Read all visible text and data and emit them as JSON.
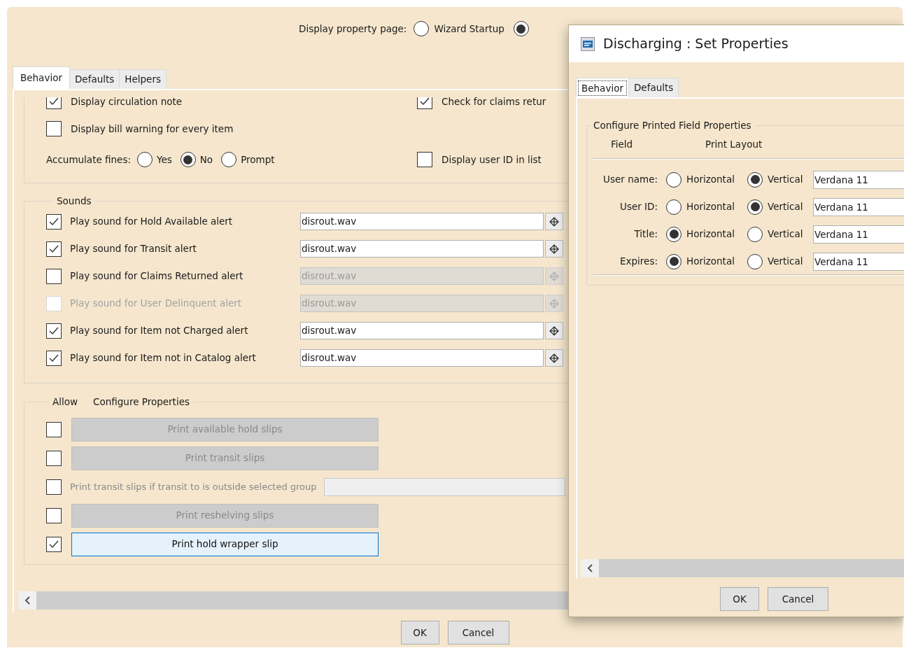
{
  "main_window": {
    "display_property_page": {
      "label": "Display property page:",
      "options": [
        {
          "label": "Wizard Startup",
          "selected": false
        },
        {
          "selected": true
        }
      ]
    },
    "tabs": [
      {
        "label": "Behavior",
        "selected": true
      },
      {
        "label": "Defaults",
        "selected": false
      },
      {
        "label": "Helpers",
        "selected": false
      }
    ],
    "general_rows": [
      {
        "left": {
          "kind": "checkbox",
          "label": "Display circulation note",
          "checked": true
        },
        "right": {
          "kind": "checkbox",
          "label": "Check for claims retur",
          "checked": true
        }
      },
      {
        "left": {
          "kind": "checkbox",
          "label": "Display bill warning for every item",
          "checked": false
        }
      },
      {
        "left": {
          "kind": "radio_group",
          "label": "Accumulate fines:",
          "options": [
            {
              "label": "Yes",
              "selected": false
            },
            {
              "label": "No",
              "selected": true
            },
            {
              "label": "Prompt",
              "selected": false
            }
          ]
        },
        "right": {
          "kind": "checkbox",
          "label": "Display user ID in list",
          "checked": false
        }
      }
    ],
    "sounds": {
      "title": "Sounds",
      "rows": [
        {
          "label": "Play sound for Hold Available alert",
          "checked": true,
          "disabled": false,
          "file": "disrout.wav"
        },
        {
          "label": "Play sound for Transit alert",
          "checked": true,
          "disabled": false,
          "file": "disrout.wav"
        },
        {
          "label": "Play sound for Claims Returned alert",
          "checked": false,
          "disabled": false,
          "file": "disrout.wav"
        },
        {
          "label": "Play sound for User Delinquent alert",
          "checked": false,
          "disabled": true,
          "file": "disrout.wav"
        },
        {
          "label": "Play sound for Item not Charged alert",
          "checked": true,
          "disabled": false,
          "file": "disrout.wav"
        },
        {
          "label": "Play sound for Item not in Catalog alert",
          "checked": true,
          "disabled": false,
          "file": "disrout.wav"
        }
      ]
    },
    "allow": {
      "title": "Allow",
      "subtitle": "Configure Properties",
      "rows": [
        {
          "kind": "button",
          "label": "Print available hold slips",
          "checked": false
        },
        {
          "kind": "button",
          "label": "Print transit slips",
          "checked": false
        },
        {
          "kind": "field",
          "label": "Print transit slips if transit to is outside selected group",
          "checked": false
        },
        {
          "kind": "button",
          "label": "Print reshelving slips",
          "checked": false
        },
        {
          "kind": "button",
          "label": "Print hold wrapper slip",
          "checked": true
        }
      ]
    },
    "buttons": [
      "OK",
      "Cancel"
    ]
  },
  "dialog": {
    "title": "Discharging : Set Properties",
    "tabs": [
      {
        "label": "Behavior",
        "selected": true
      },
      {
        "label": "Defaults",
        "selected": false
      }
    ],
    "group_title": "Configure Printed Field Properties",
    "columns": [
      "Field",
      "Print Layout"
    ],
    "rows": [
      {
        "label": "User name:",
        "options": [
          {
            "label": "Horizontal",
            "selected": false
          },
          {
            "label": "Vertical",
            "selected": true
          }
        ],
        "font": "Verdana 11"
      },
      {
        "label": "User ID:",
        "options": [
          {
            "label": "Horizontal",
            "selected": false
          },
          {
            "label": "Vertical",
            "selected": true
          }
        ],
        "font": "Verdana 11"
      },
      {
        "label": "Title:",
        "options": [
          {
            "label": "Horizontal",
            "selected": true
          },
          {
            "label": "Vertical",
            "selected": false
          }
        ],
        "font": "Verdana 11"
      },
      {
        "label": "Expires:",
        "options": [
          {
            "label": "Horizontal",
            "selected": true
          },
          {
            "label": "Vertical",
            "selected": false
          }
        ],
        "font": "Verdana 11"
      }
    ],
    "buttons": [
      "OK",
      "Cancel"
    ]
  }
}
